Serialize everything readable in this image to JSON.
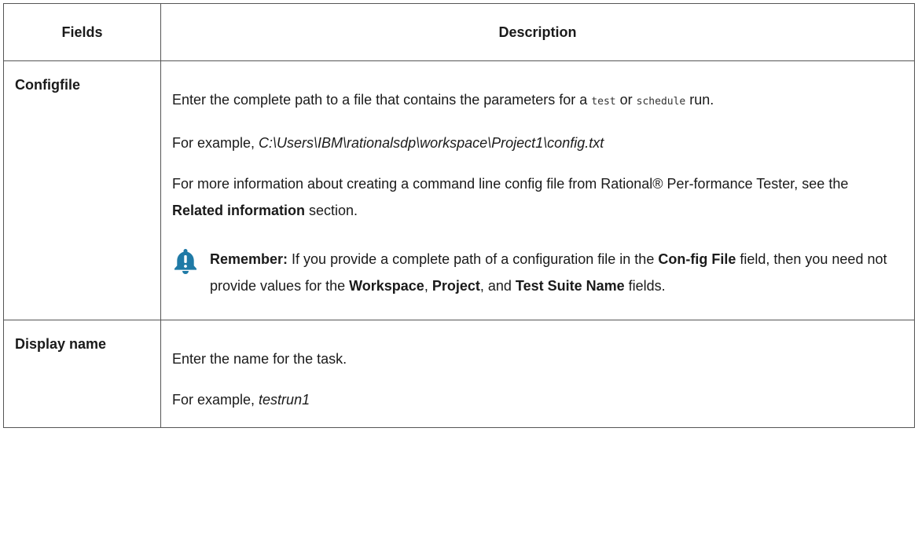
{
  "table": {
    "headers": {
      "fields": "Fields",
      "description": "Description"
    },
    "rows": {
      "configfile": {
        "field": "Configfile",
        "p1_pre": "Enter the complete path to a file that contains the parameters for a ",
        "p1_code1": "test",
        "p1_mid": " or ",
        "p1_code2": "schedule",
        "p1_post": " run.",
        "p2_pre": "For example, ",
        "p2_path": "C:\\Users\\IBM\\rationalsdp\\workspace\\Project1\\config.txt",
        "p3_pre": "For more information about creating a command line config file from  Rational® Per-formance Tester, see the ",
        "p3_bold": "Related information",
        "p3_post": " section.",
        "note": {
          "label": "Remember:",
          "t1": " If you provide a complete path of a configuration file in the ",
          "b1": "Con-fig File",
          "t2": " field, then you need not provide values for the ",
          "b2": "Workspace",
          "t3": ", ",
          "b3": "Project",
          "t4": ", and ",
          "b4": "Test Suite Name",
          "t5": " fields.",
          "icon": "bell-icon",
          "icon_color": "#1f7aa6"
        }
      },
      "display_name": {
        "field": "Display name",
        "p1": "Enter the name for the task.",
        "p2_pre": "For example, ",
        "p2_example": "testrun1"
      }
    }
  }
}
